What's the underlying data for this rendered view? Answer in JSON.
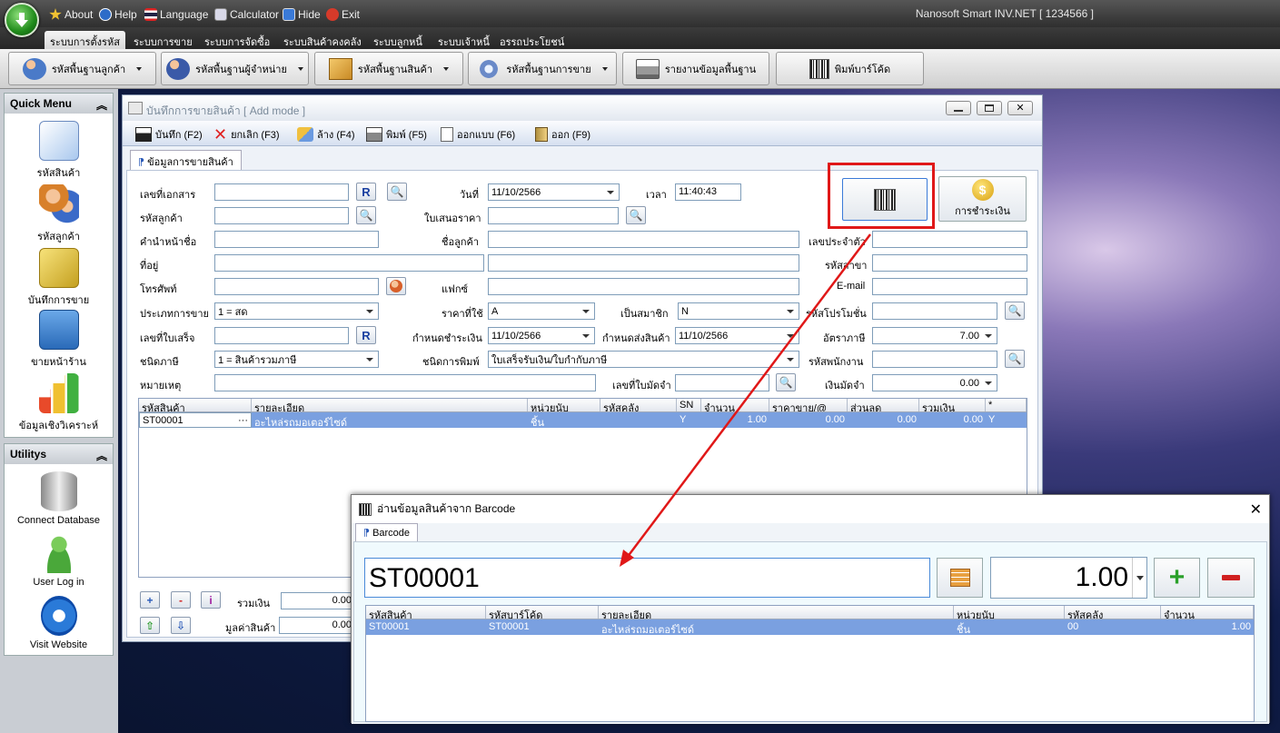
{
  "app": {
    "title": "Nanosoft Smart INV.NET  [ 1234566 ]",
    "top_items": [
      "About",
      "Help",
      "Language",
      "Calculator",
      "Hide",
      "Exit"
    ],
    "menu": [
      "ระบบการตั้งรหัส",
      "ระบบการขาย",
      "ระบบการจัดซื้อ",
      "ระบบสินค้าคงคลัง",
      "ระบบลูกหนี้",
      "ระบบเจ้าหนี้",
      "อรรถประโยชน์"
    ],
    "ribbon": [
      "รหัสพื้นฐานลูกค้า",
      "รหัสพื้นฐานผู้จำหน่าย",
      "รหัสพื้นฐานสินค้า",
      "รหัสพื้นฐานการขาย",
      "รายงานข้อมูลพื้นฐาน",
      "พิมพ์บาร์โค้ด"
    ]
  },
  "sidebar": {
    "quick_title": "Quick Menu",
    "quick_items": [
      "รหัสสินค้า",
      "รหัสลูกค้า",
      "บันทึกการขาย",
      "ขายหน้าร้าน",
      "ข้อมูลเชิงวิเคราะห์"
    ],
    "util_title": "Utilitys",
    "util_items": [
      "Connect Database",
      "User Log in",
      "Visit Website"
    ]
  },
  "main": {
    "title": "บันทึกการขายสินค้า [ Add mode ]",
    "tools": [
      "บันทึก (F2)",
      "ยกเลิก (F3)",
      "ล้าง (F4)",
      "พิมพ์ (F5)",
      "ออกแบบ (F6)",
      "ออก (F9)"
    ],
    "tab": "ข้อมูลการขายสินค้า",
    "labels": {
      "doc_no": "เลขที่เอกสาร",
      "date": "วันที่",
      "time": "เวลา",
      "customer_code": "รหัสลูกค้า",
      "quotation": "ใบเสนอราคา",
      "title_prefix": "คำนำหน้าชื่อ",
      "customer_name": "ชื่อลูกค้า",
      "tax_id": "เลขประจำตัว",
      "address": "ที่อยู่",
      "branch": "รหัสสาขา",
      "phone": "โทรศัพท์",
      "fax": "แฟกซ์",
      "email": "E-mail",
      "sale_type": "ประเภทการขาย",
      "price_used": "ราคาที่ใช้",
      "member": "เป็นสมาชิก",
      "promo": "รหัสโปรโมชั่น",
      "receipt_no": "เลขที่ใบเสร็จ",
      "pay_due": "กำหนดชำระเงิน",
      "delivery_due": "กำหนดส่งสินค้า",
      "tax_rate": "อัตราภาษี",
      "tax_type": "ชนิดภาษี",
      "print_type": "ชนิดการพิมพ์",
      "employee": "รหัสพนักงาน",
      "note": "หมายเหตุ",
      "deposit_no": "เลขที่ใบมัดจำ",
      "deposit": "เงินมัดจำ",
      "payment_btn": "การชำระเงิน",
      "total": "รวมเงิน",
      "goods_value": "มูลค่าสินค้า"
    },
    "values": {
      "date": "11/10/2566",
      "time": "11:40:43",
      "sale_type": "1 = สด",
      "price_used": "A",
      "member": "N",
      "pay_due": "11/10/2566",
      "delivery_due": "11/10/2566",
      "tax_rate": "7.00",
      "tax_type": "1 = สินค้ารวมภาษี",
      "print_type": "ใบเสร็จรับเงิน/ใบกำกับภาษี",
      "deposit": "0.00",
      "total": "0.00",
      "goods_value": "0.00",
      "btn_r": "R"
    },
    "grid": {
      "headers": [
        "รหัสสินค้า",
        "รายละเอียด",
        "หน่วยนับ",
        "รหัสคลัง",
        "SN",
        "จำนวน",
        "ราคาขาย/@",
        "ส่วนลด",
        "รวมเงิน",
        "*"
      ],
      "rows": [
        [
          "ST00001",
          "อะไหล่รถมอเตอร์ไซด์",
          "ชิ้น",
          "",
          "Y",
          "1.00",
          "0.00",
          "0.00",
          "0.00",
          "Y"
        ]
      ]
    },
    "grid_buttons": [
      "+",
      "-",
      "i"
    ]
  },
  "barcode_dialog": {
    "title": "อ่านข้อมูลสินค้าจาก Barcode",
    "tab": "Barcode",
    "input_value": "ST00001",
    "qty_value": "1.00",
    "grid": {
      "headers": [
        "รหัสสินค้า",
        "รหัสบาร์โค้ด",
        "รายละเอียด",
        "หน่วยนับ",
        "รหัสคลัง",
        "จำนวน"
      ],
      "rows": [
        [
          "ST00001",
          "ST00001",
          "อะไหล่รถมอเตอร์ไซด์",
          "ชิ้น",
          "00",
          "1.00"
        ]
      ]
    }
  }
}
